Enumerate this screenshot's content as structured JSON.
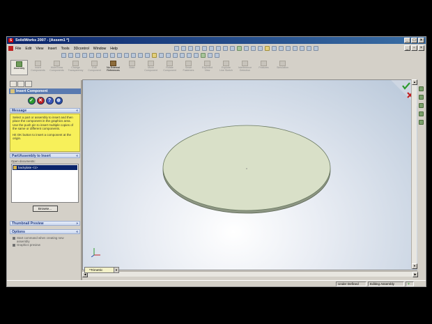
{
  "window": {
    "title": "SolidWorks 2007 - [Assem1 *]"
  },
  "menu": [
    "File",
    "Edit",
    "View",
    "Insert",
    "Tools",
    "3Dcontrol",
    "Window",
    "Help"
  ],
  "command_manager": {
    "items": [
      {
        "label": "Assembly",
        "state": "active"
      },
      {
        "label": "Insert\nComponents",
        "state": "disabled"
      },
      {
        "label": "Hide/Show\nComponents",
        "state": "disabled"
      },
      {
        "label": "Change\nTransparency",
        "state": "disabled"
      },
      {
        "label": "Edit\nComponent",
        "state": "disabled"
      },
      {
        "label": "No External\nReferences",
        "state": "normal"
      },
      {
        "label": "Mate",
        "state": "disabled"
      },
      {
        "label": "Move\nComponent",
        "state": "disabled"
      },
      {
        "label": "Rotate\nComponent",
        "state": "disabled"
      },
      {
        "label": "Smart\nFasteners",
        "state": "disabled"
      },
      {
        "label": "Exploded\nView",
        "state": "disabled"
      },
      {
        "label": "Explode\nLine Sketch",
        "state": "disabled"
      },
      {
        "label": "Interference\nDetection",
        "state": "disabled"
      },
      {
        "label": "Features",
        "state": "disabled"
      },
      {
        "label": "Simulation",
        "state": "disabled"
      }
    ]
  },
  "property_manager": {
    "title": "Insert Component",
    "message": {
      "header": "Message",
      "text1": "Select a part or assembly to insert and then place the component in the graphics area. Use the push pin to insert multiple copies of the same or different components.",
      "text2": "Hit OK button to insert a component at the origin."
    },
    "part_group": {
      "header": "Part/Assembly to Insert",
      "open_documents_label": "Open documents:",
      "documents": [
        "backplate <1>"
      ],
      "browse_label": "Browse..."
    },
    "thumbnail": {
      "header": "Thumbnail Preview"
    },
    "options": {
      "header": "Options",
      "items": [
        {
          "label": "Start command when creating new assembly",
          "checked": true
        },
        {
          "label": "Graphics preview",
          "checked": true
        }
      ]
    }
  },
  "graphics": {
    "view_orientation": "*Trimetric"
  },
  "status_bar": {
    "state": "Under Defined",
    "mode": "Editing Assembly"
  },
  "colors": {
    "part_fill": "#d9e0c8",
    "part_edge": "#6b7a62",
    "ok_green": "#2d9a2d",
    "cancel_red": "#c02020"
  }
}
